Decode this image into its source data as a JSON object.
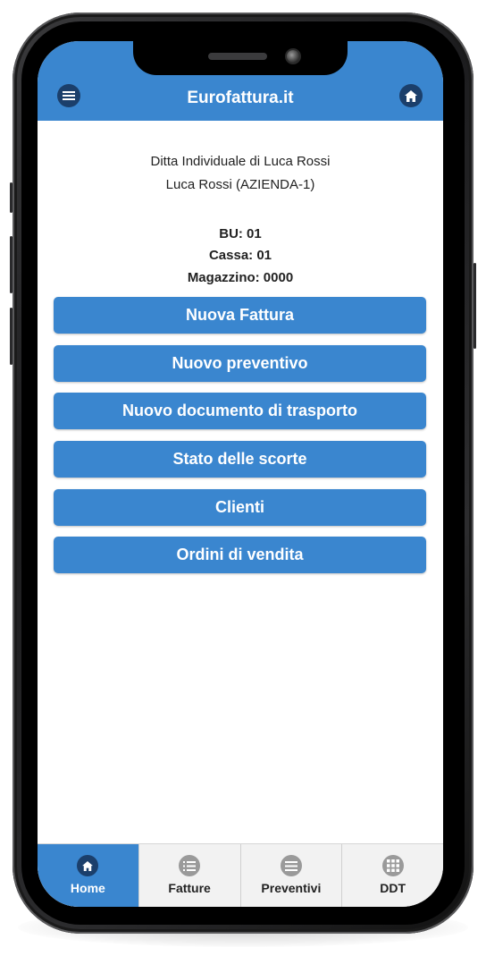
{
  "app": {
    "title": "Eurofattura.it",
    "menu_icon": "hamburger-menu-icon",
    "home_icon": "home-icon"
  },
  "company": {
    "name": "Ditta Individuale di Luca Rossi",
    "user": "Luca Rossi (AZIENDA-1)"
  },
  "context": {
    "bu": "BU: 01",
    "cassa": "Cassa: 01",
    "magazzino": "Magazzino: 0000"
  },
  "actions": [
    {
      "label": "Nuova Fattura"
    },
    {
      "label": "Nuovo preventivo"
    },
    {
      "label": "Nuovo documento di trasporto"
    },
    {
      "label": "Stato delle scorte"
    },
    {
      "label": "Clienti"
    },
    {
      "label": "Ordini di vendita"
    }
  ],
  "tabs": [
    {
      "label": "Home",
      "icon": "home-icon",
      "active": true
    },
    {
      "label": "Fatture",
      "icon": "list-icon",
      "active": false
    },
    {
      "label": "Preventivi",
      "icon": "menu-lines-icon",
      "active": false
    },
    {
      "label": "DDT",
      "icon": "grid-icon",
      "active": false
    }
  ],
  "colors": {
    "primary": "#3a86cf",
    "icon_dark": "#1b3f6b",
    "tab_bg": "#f2f2f2"
  }
}
